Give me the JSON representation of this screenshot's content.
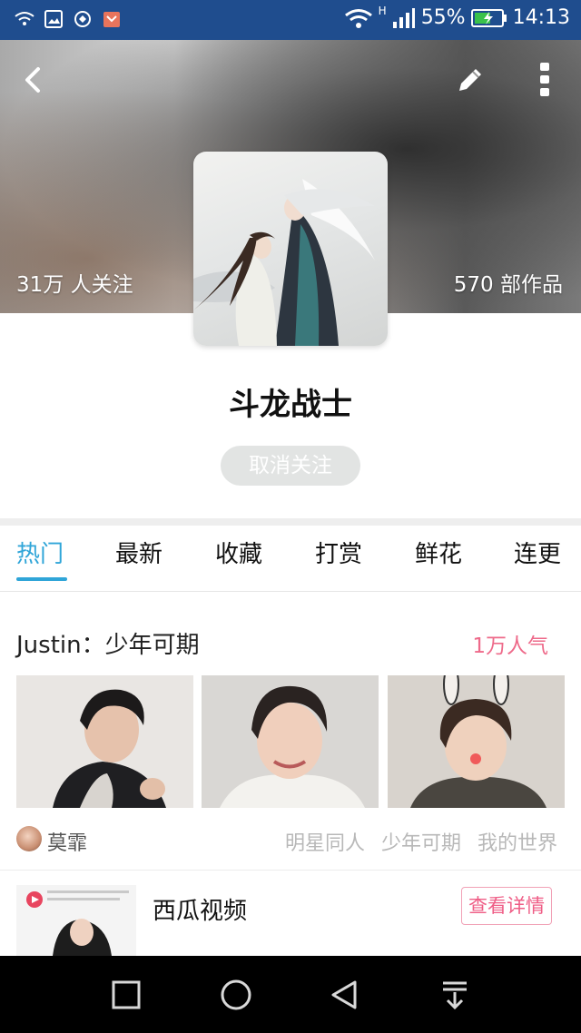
{
  "status_bar": {
    "battery": "55%",
    "time": "14:13",
    "network": "H"
  },
  "header": {
    "followers": "31万 人关注",
    "works": "570 部作品"
  },
  "profile": {
    "title": "斗龙战士",
    "unfollow_label": "取消关注"
  },
  "tabs": [
    {
      "label": "热门",
      "active": true
    },
    {
      "label": "最新",
      "active": false
    },
    {
      "label": "收藏",
      "active": false
    },
    {
      "label": "打赏",
      "active": false
    },
    {
      "label": "鲜花",
      "active": false
    },
    {
      "label": "连更",
      "active": false
    }
  ],
  "post": {
    "title": "Justin：少年可期",
    "popularity": "1万人气",
    "author": "莫霏",
    "tags": [
      "明星同人",
      "少年可期",
      "我的世界"
    ]
  },
  "ad": {
    "title": "西瓜视频",
    "button_label": "查看详情"
  },
  "colors": {
    "accent": "#2fa5d8",
    "pink": "#ee6a8a",
    "status_bar": "#1f4d8e"
  },
  "icons": {
    "back": "chevron-left-icon",
    "edit": "pencil-icon",
    "more": "more-vertical-icon"
  }
}
